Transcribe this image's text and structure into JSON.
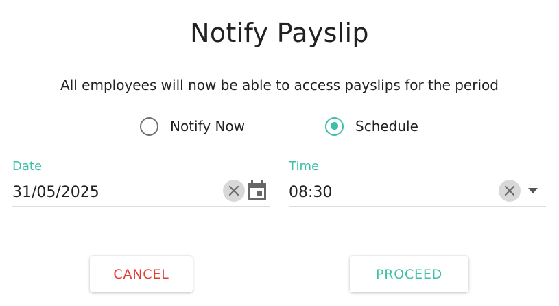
{
  "dialog": {
    "title": "Notify Payslip",
    "subtitle": "All employees will now be able to access payslips for the period"
  },
  "notify_options": {
    "selected": "Schedule",
    "options": [
      {
        "label": "Notify Now",
        "checked": false
      },
      {
        "label": "Schedule",
        "checked": true
      }
    ]
  },
  "date_field": {
    "label": "Date",
    "value": "31/05/2025",
    "clear_icon": "close-icon",
    "picker_icon": "calendar-icon"
  },
  "time_field": {
    "label": "Time",
    "value": "08:30",
    "clear_icon": "close-icon",
    "dropdown_icon": "arrow-drop-down-icon"
  },
  "actions": {
    "cancel_label": "CANCEL",
    "proceed_label": "PROCEED"
  },
  "colors": {
    "accent": "#3dbfa8",
    "cancel": "#e53935",
    "text": "#222222",
    "radio_unchecked": "#707070",
    "divider": "#dcdcdc",
    "clear_bg": "#d8d8d8"
  }
}
